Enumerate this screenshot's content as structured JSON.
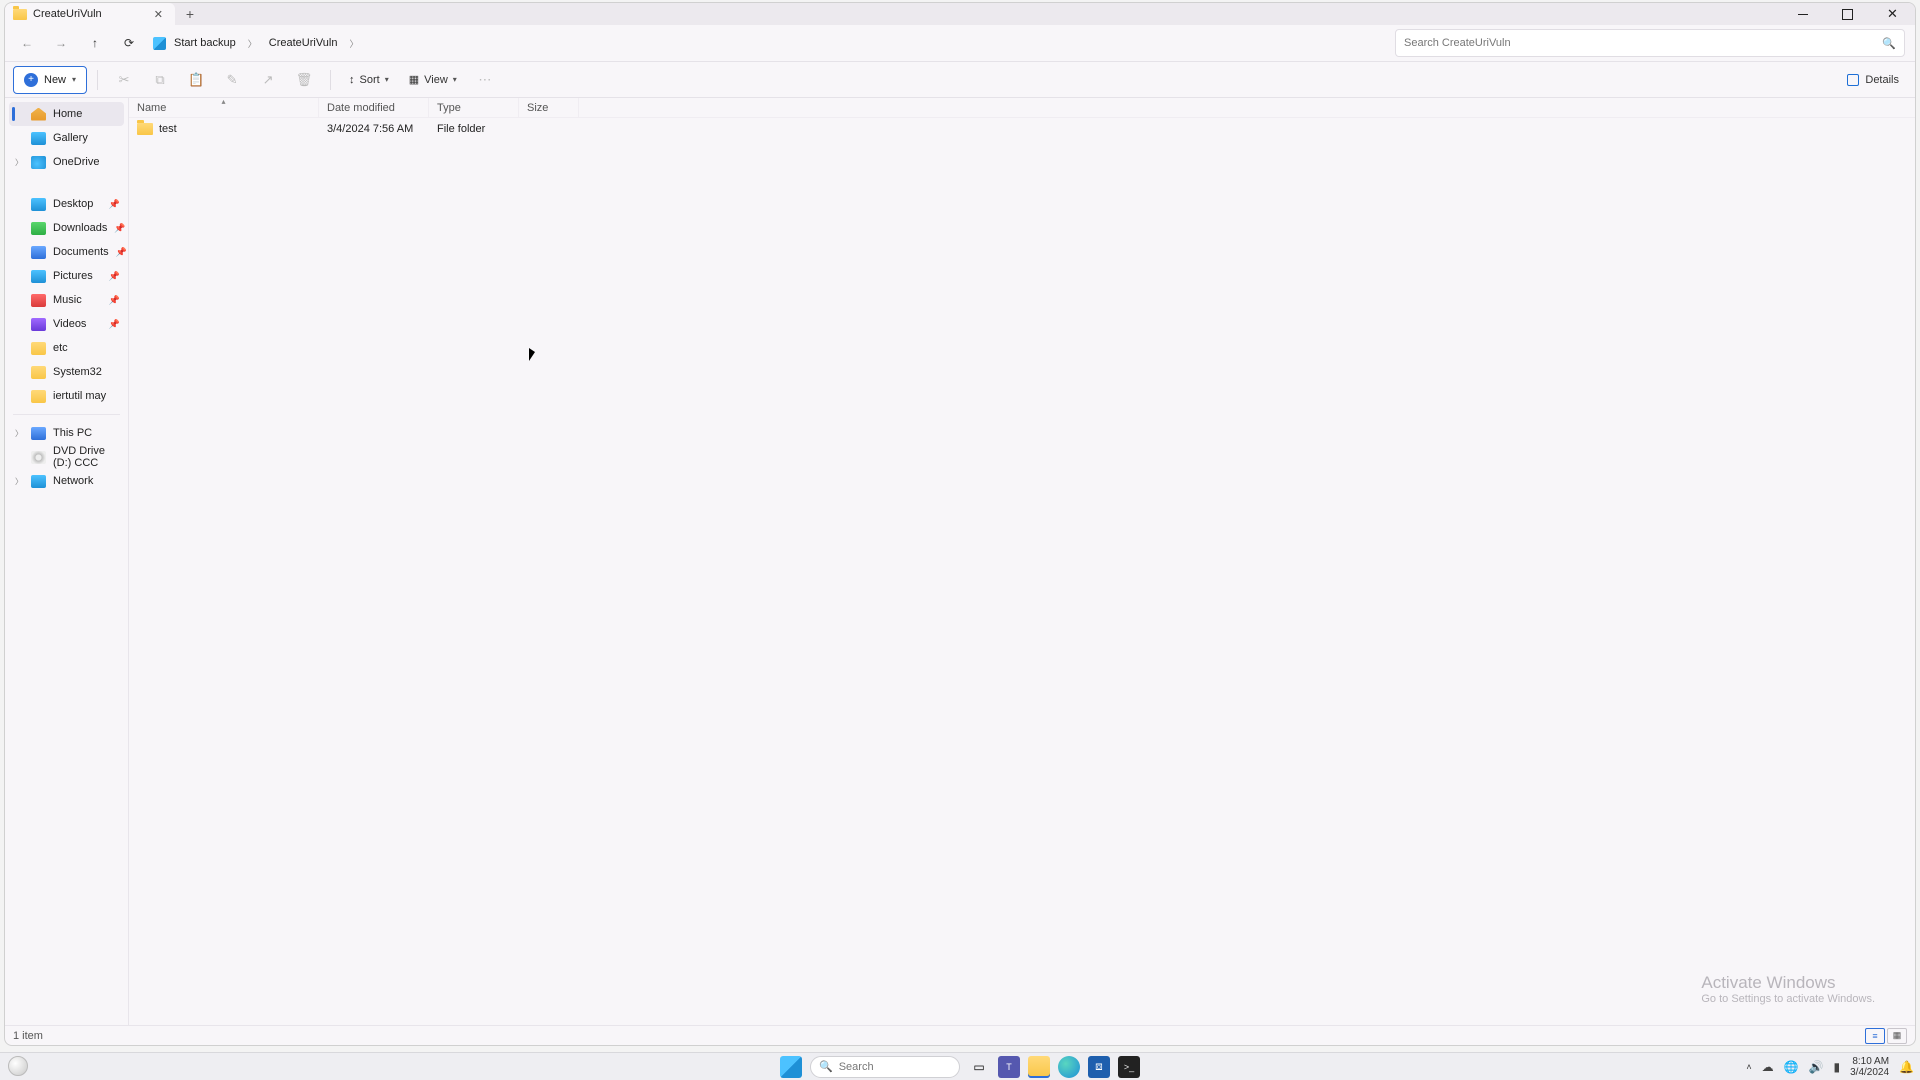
{
  "tab": {
    "title": "CreateUriVuln"
  },
  "breadcrumbs": [
    {
      "label": "Start backup"
    },
    {
      "label": "CreateUriVuln"
    }
  ],
  "search": {
    "placeholder": "Search CreateUriVuln"
  },
  "toolbar": {
    "new": "New",
    "sort": "Sort",
    "view": "View",
    "details": "Details"
  },
  "columns": {
    "name": "Name",
    "date": "Date modified",
    "type": "Type",
    "size": "Size"
  },
  "rows": [
    {
      "name": "test",
      "date": "3/4/2024 7:56 AM",
      "type": "File folder",
      "size": ""
    }
  ],
  "sidebar": {
    "home": "Home",
    "gallery": "Gallery",
    "onedrive": "OneDrive",
    "desktop": "Desktop",
    "downloads": "Downloads",
    "documents": "Documents",
    "pictures": "Pictures",
    "music": "Music",
    "videos": "Videos",
    "etc": "etc",
    "system32": "System32",
    "iertutil": "iertutil may",
    "thispc": "This PC",
    "dvd": "DVD Drive (D:) CCC",
    "network": "Network"
  },
  "status": {
    "count": "1 item"
  },
  "watermark": {
    "l1": "Activate Windows",
    "l2": "Go to Settings to activate Windows."
  },
  "taskbar": {
    "search": "Search",
    "time": "8:10 AM",
    "date": "3/4/2024"
  }
}
